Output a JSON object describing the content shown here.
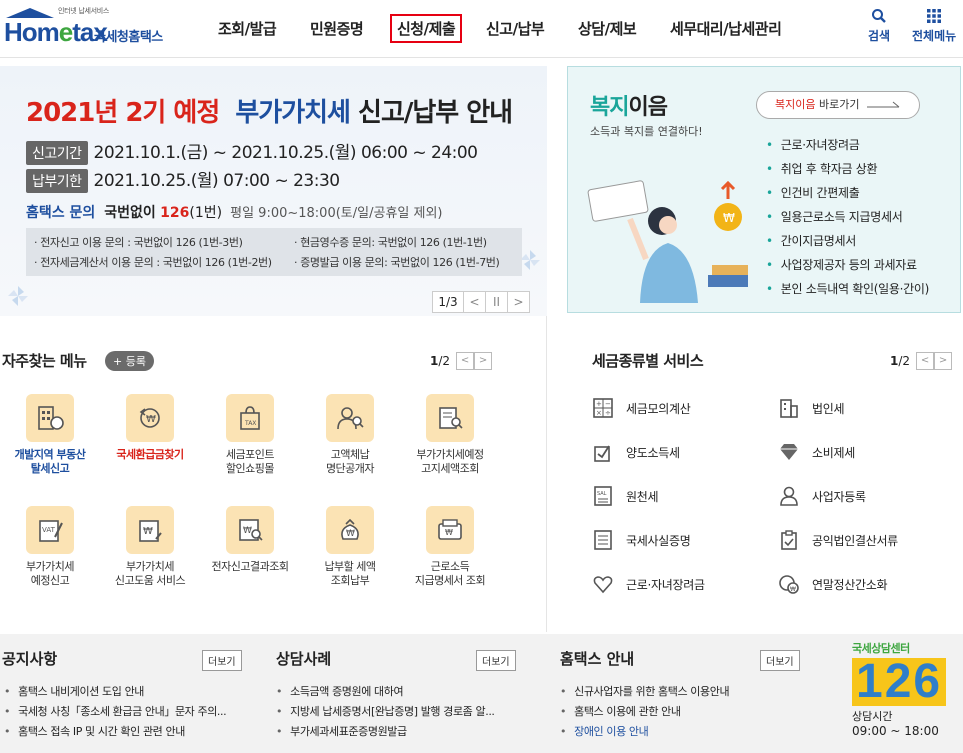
{
  "header": {
    "logo_small": "인터넷 납세서비스",
    "logo_word_1": "Hom",
    "logo_word_e": "e",
    "logo_word_2": "tax",
    "logo_kor": "국세청홈택스",
    "nav": [
      "조회/발급",
      "민원증명",
      "신청/제출",
      "신고/납부",
      "상담/제보",
      "세무대리/납세관리"
    ],
    "active_nav": "신청/제출",
    "search_label": "검색",
    "menu_label": "전체메뉴"
  },
  "banner": {
    "title_red": "2021년 2기 예정",
    "title_blue": "부가가치세",
    "title_rest": "신고/납부 안내",
    "period_tag": "신고기간",
    "period_value": "2021.10.1.(금) ~ 2021.10.25.(월) 06:00 ~ 24:00",
    "due_tag": "납부기한",
    "due_value": "2021.10.25.(월) 07:00 ~ 23:30",
    "inquiry_label": "홈택스 문의",
    "inquiry_pre": "국번없이",
    "inquiry_num": "126",
    "inquiry_post": "(1번)",
    "inquiry_hours": "평일 9:00~18:00(토/일/공휴일 제외)",
    "info": [
      "· 전자신고 이용 문의 : 국번없이 126 (1번-3번)",
      "· 현금영수증 문의: 국번없이 126 (1번-1번)",
      "· 전자세금계산서 이용 문의 : 국번없이 126 (1번-2번)",
      "· 증명발급 이용 문의: 국번없이 126 (1번-7번)"
    ],
    "pager": "1/3",
    "prev": "<",
    "pause": "II",
    "next": ">"
  },
  "welfare": {
    "title_teal": "복지",
    "title_rest": "이음",
    "subtitle": "소득과 복지를 연결하다!",
    "btn_hl": "복지이음",
    "btn_rest": "바로가기",
    "items": [
      "근로·자녀장려금",
      "취업 후 학자금 상환",
      "인건비 간편제출",
      "일용근로소득 지급명세서",
      "간이지급명세서",
      "사업장제공자 등의 과세자료",
      "본인 소득내역 확인(일용·간이)"
    ]
  },
  "freq": {
    "title": "자주찾는 메뉴",
    "add": "+ 등록",
    "page_cur": "1",
    "page_total": "/2",
    "items": [
      {
        "label1": "개발지역 부동산",
        "label2": "탈세신고",
        "style": "blue",
        "icon": "building-icon"
      },
      {
        "label1": "국세환급금찾기",
        "label2": "",
        "style": "red",
        "icon": "refund-icon"
      },
      {
        "label1": "세금포인트",
        "label2": "할인쇼핑몰",
        "style": "",
        "icon": "shopping-bag-icon"
      },
      {
        "label1": "고액체납",
        "label2": "명단공개자",
        "style": "",
        "icon": "people-search-icon"
      },
      {
        "label1": "부가가치세예정",
        "label2": "고지세액조회",
        "style": "",
        "icon": "document-search-icon"
      },
      {
        "label1": "부가가치세",
        "label2": "예정신고",
        "style": "",
        "icon": "vat-icon"
      },
      {
        "label1": "부가가치세",
        "label2": "신고도움 서비스",
        "style": "",
        "icon": "vat-help-icon"
      },
      {
        "label1": "전자신고결과조회",
        "label2": "",
        "style": "",
        "icon": "result-search-icon"
      },
      {
        "label1": "납부할 세액",
        "label2": "조회납부",
        "style": "",
        "icon": "tax-payment-icon"
      },
      {
        "label1": "근로소득",
        "label2": "지급명세서 조회",
        "style": "",
        "icon": "wallet-icon"
      }
    ]
  },
  "tax_services": {
    "title": "세금종류별 서비스",
    "page_cur": "1",
    "page_total": "/2",
    "items": [
      {
        "label": "세금모의계산",
        "icon": "calculator-icon"
      },
      {
        "label": "법인세",
        "icon": "corporation-icon"
      },
      {
        "label": "양도소득세",
        "icon": "transfer-icon"
      },
      {
        "label": "소비제세",
        "icon": "diamond-icon"
      },
      {
        "label": "원천세",
        "icon": "withholding-icon"
      },
      {
        "label": "사업자등록",
        "icon": "person-register-icon"
      },
      {
        "label": "국세사실증명",
        "icon": "certificate-icon"
      },
      {
        "label": "공익법인결산서류",
        "icon": "clipboard-icon"
      },
      {
        "label": "근로·자녀장려금",
        "icon": "heart-icon"
      },
      {
        "label": "연말정산간소화",
        "icon": "year-end-icon"
      }
    ]
  },
  "notice": {
    "title": "공지사항",
    "more": "더보기",
    "items": [
      "홈택스 내비게이션 도입 안내",
      "국세청 사칭「종소세 환급금 안내」문자 주의...",
      "홈택스 접속 IP 및 시간 확인 관련 안내"
    ]
  },
  "consult": {
    "title": "상담사례",
    "more": "더보기",
    "items": [
      "소득금액 증명원에 대하여",
      "지방세 납세증명서[완납증명] 발행 경로좀 알...",
      "부가세과세표준증명원발급"
    ]
  },
  "guide": {
    "title": "홈택스 안내",
    "more": "더보기",
    "items": [
      "신규사업자를 위한 홈택스 이용안내",
      "홈택스 이용에 관한 안내",
      "장애인 이용 안내"
    ]
  },
  "callcenter": {
    "head": "국세상담센터",
    "number": "126",
    "hours_label": "상담시간",
    "hours": "09:00 ~ 18:00"
  },
  "colors": {
    "brand_blue": "#1e4f9f",
    "accent_red": "#d9241b",
    "teal": "#1aa59a",
    "icon_bg": "#fbe3b4"
  }
}
